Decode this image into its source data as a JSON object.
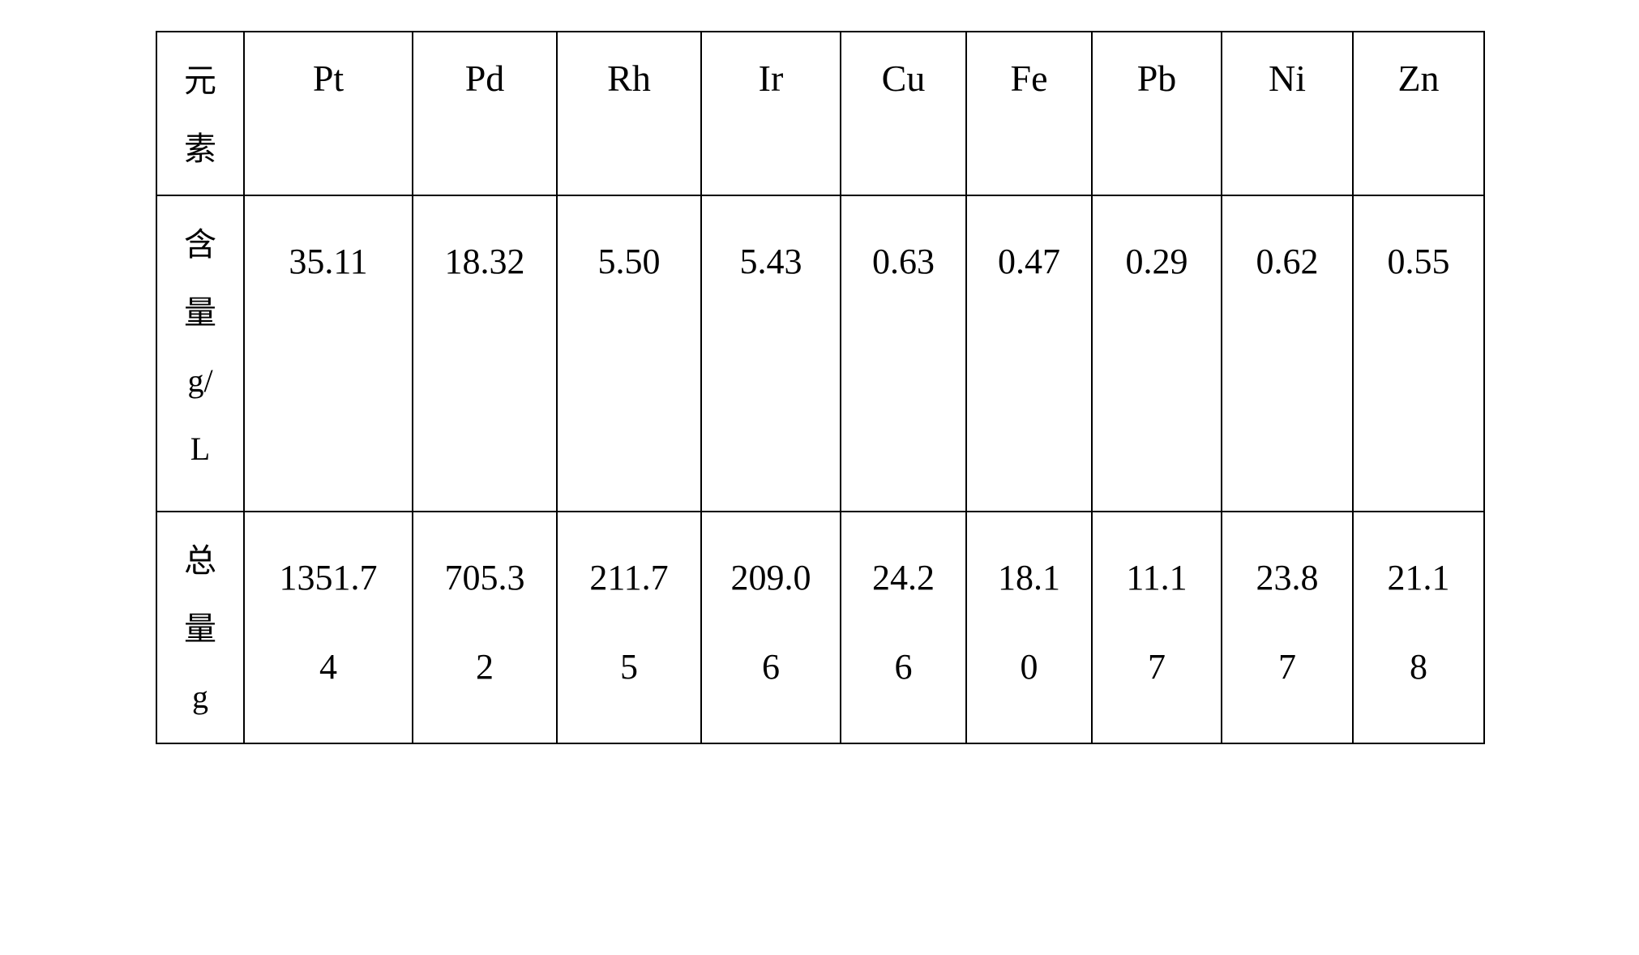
{
  "table": {
    "columns": [
      {
        "key": "label",
        "header": [
          "元",
          "素"
        ]
      },
      {
        "key": "pt",
        "header": "Pt"
      },
      {
        "key": "pd",
        "header": "Pd"
      },
      {
        "key": "rh",
        "header": "Rh"
      },
      {
        "key": "ir",
        "header": "Ir"
      },
      {
        "key": "cu",
        "header": "Cu"
      },
      {
        "key": "fe",
        "header": "Fe"
      },
      {
        "key": "pb",
        "header": "Pb"
      },
      {
        "key": "ni",
        "header": "Ni"
      },
      {
        "key": "zn",
        "header": "Zn"
      }
    ],
    "header_label_chars": [
      "元",
      "素"
    ],
    "rows": [
      {
        "label_chars": [
          "含",
          "量",
          "g/",
          "L"
        ],
        "label_text": "含量 g/L",
        "values": [
          "35.11",
          "18.32",
          "5.50",
          "5.43",
          "0.63",
          "0.47",
          "0.29",
          "0.62",
          "0.55"
        ],
        "value_lines": [
          [
            "35.11"
          ],
          [
            "18.32"
          ],
          [
            "5.50"
          ],
          [
            "5.43"
          ],
          [
            "0.63"
          ],
          [
            "0.47"
          ],
          [
            "0.29"
          ],
          [
            "0.62"
          ],
          [
            "0.55"
          ]
        ]
      },
      {
        "label_chars": [
          "总",
          "量",
          "g"
        ],
        "label_text": "总量 g",
        "values": [
          "1351.74",
          "705.32",
          "211.75",
          "209.06",
          "24.26",
          "18.10",
          "11.17",
          "23.87",
          "21.18"
        ],
        "value_lines": [
          [
            "1351.7",
            "4"
          ],
          [
            "705.3",
            "2"
          ],
          [
            "211.7",
            "5"
          ],
          [
            "209.0",
            "6"
          ],
          [
            "24.2",
            "6"
          ],
          [
            "18.1",
            "0"
          ],
          [
            "11.1",
            "7"
          ],
          [
            "23.8",
            "7"
          ],
          [
            "21.1",
            "8"
          ]
        ]
      }
    ]
  },
  "chart_data": {
    "type": "table",
    "title": "",
    "categories": [
      "Pt",
      "Pd",
      "Rh",
      "Ir",
      "Cu",
      "Fe",
      "Pb",
      "Ni",
      "Zn"
    ],
    "series": [
      {
        "name": "含量 g/L",
        "values": [
          35.11,
          18.32,
          5.5,
          5.43,
          0.63,
          0.47,
          0.29,
          0.62,
          0.55
        ]
      },
      {
        "name": "总量 g",
        "values": [
          1351.74,
          705.32,
          211.75,
          209.06,
          24.26,
          18.1,
          11.17,
          23.87,
          21.18
        ]
      }
    ],
    "row_header": "元素",
    "xlabel": "元素",
    "ylabel": ""
  }
}
